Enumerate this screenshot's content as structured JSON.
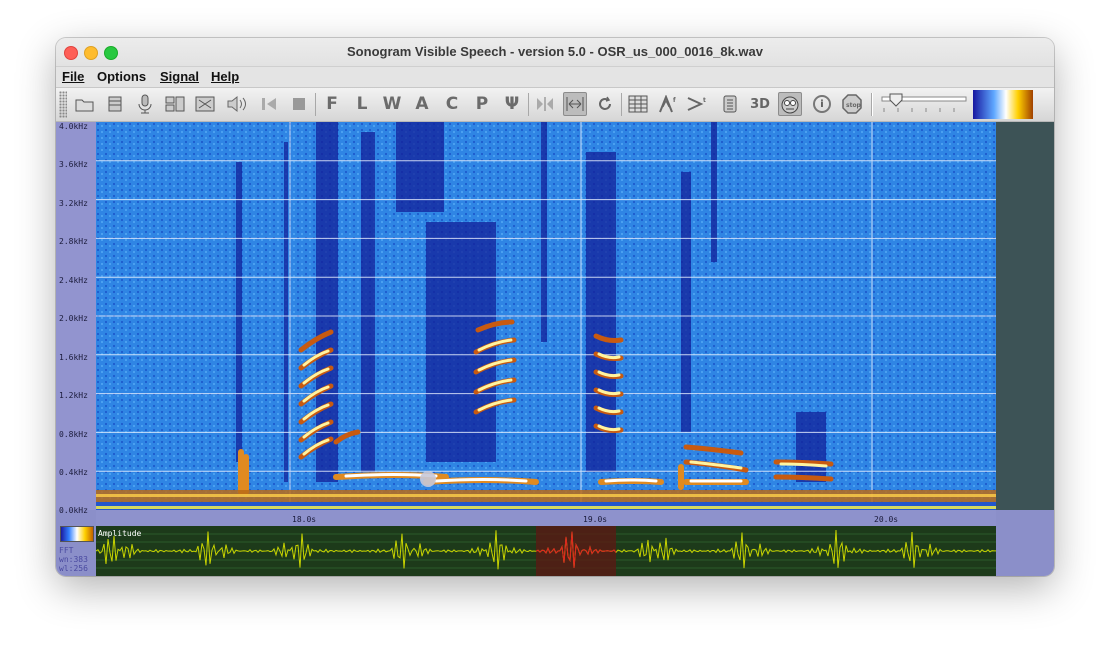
{
  "window": {
    "title": "Sonogram Visible Speech - version 5.0 - OSR_us_000_0016_8k.wav"
  },
  "menu": {
    "file": "File",
    "options": "Options",
    "signal": "Signal",
    "help": "Help"
  },
  "toolbar": {
    "icons": [
      "open-file-icon",
      "settings-icon",
      "microphone-icon",
      "layout-icon",
      "fit-icon",
      "speaker-icon",
      "rewind-icon",
      "stop-icon",
      "f-icon",
      "l-icon",
      "w-icon",
      "a-icon",
      "c-icon",
      "p-icon",
      "psi-icon",
      "mirror-icon",
      "zoom-fit-icon",
      "refresh-icon",
      "grid-icon",
      "pitch-up-icon",
      "pitch-right-icon",
      "script-icon",
      "3d-icon",
      "face-icon",
      "info-icon",
      "stop-sign-icon"
    ],
    "labels": {
      "f": "F",
      "l": "L",
      "w": "W",
      "a": "A",
      "c": "C",
      "p": "P",
      "psi": "Ψ",
      "d3": "3D"
    }
  },
  "spectrogram": {
    "y_labels": [
      "4.0kHz",
      "3.6kHz",
      "3.2kHz",
      "2.8kHz",
      "2.4kHz",
      "2.0kHz",
      "1.6kHz",
      "1.2kHz",
      "0.8kHz",
      "0.4kHz",
      "0.0kHz"
    ],
    "time_labels": [
      "18.0s",
      "19.0s",
      "20.0s"
    ]
  },
  "waveform": {
    "label": "Amplitude"
  },
  "fft_info": {
    "line1": "FFT",
    "line2": "wn:383",
    "line3": "wl:256"
  },
  "colors": {
    "spectro_bg": "#2f85e4",
    "wave_line": "#c8d400",
    "wave_highlight": "#d82020"
  }
}
